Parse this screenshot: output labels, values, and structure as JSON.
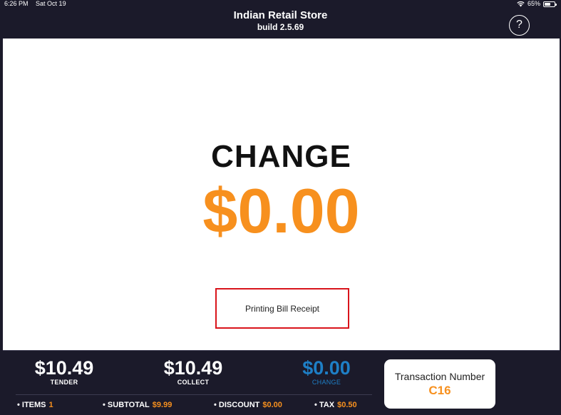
{
  "status_bar": {
    "time": "6:26 PM",
    "date": "Sat Oct 19",
    "battery": "65%",
    "battery_level": 0.65
  },
  "header": {
    "title": "Indian Retail Store",
    "build": "build 2.5.69",
    "help_label": "?"
  },
  "main": {
    "change_label": "CHANGE",
    "change_amount": "$0.00",
    "receipt_message": "Printing Bill Receipt"
  },
  "footer": {
    "tender": {
      "value": "$10.49",
      "label": "TENDER"
    },
    "collect": {
      "value": "$10.49",
      "label": "COLLECT"
    },
    "change": {
      "value": "$0.00",
      "label": "CHANGE"
    },
    "summary": {
      "items_label": "• ITEMS",
      "items_value": "1",
      "subtotal_label": "• SUBTOTAL",
      "subtotal_value": "$9.99",
      "discount_label": "• DISCOUNT",
      "discount_value": "$0.00",
      "tax_label": "• TAX",
      "tax_value": "$0.50"
    },
    "transaction": {
      "label": "Transaction Number",
      "number": "C16"
    }
  },
  "colors": {
    "accent_orange": "#f7901e",
    "change_blue": "#1e7fc6",
    "background_dark": "#1b1a2a",
    "highlight_red": "#d9141b"
  }
}
